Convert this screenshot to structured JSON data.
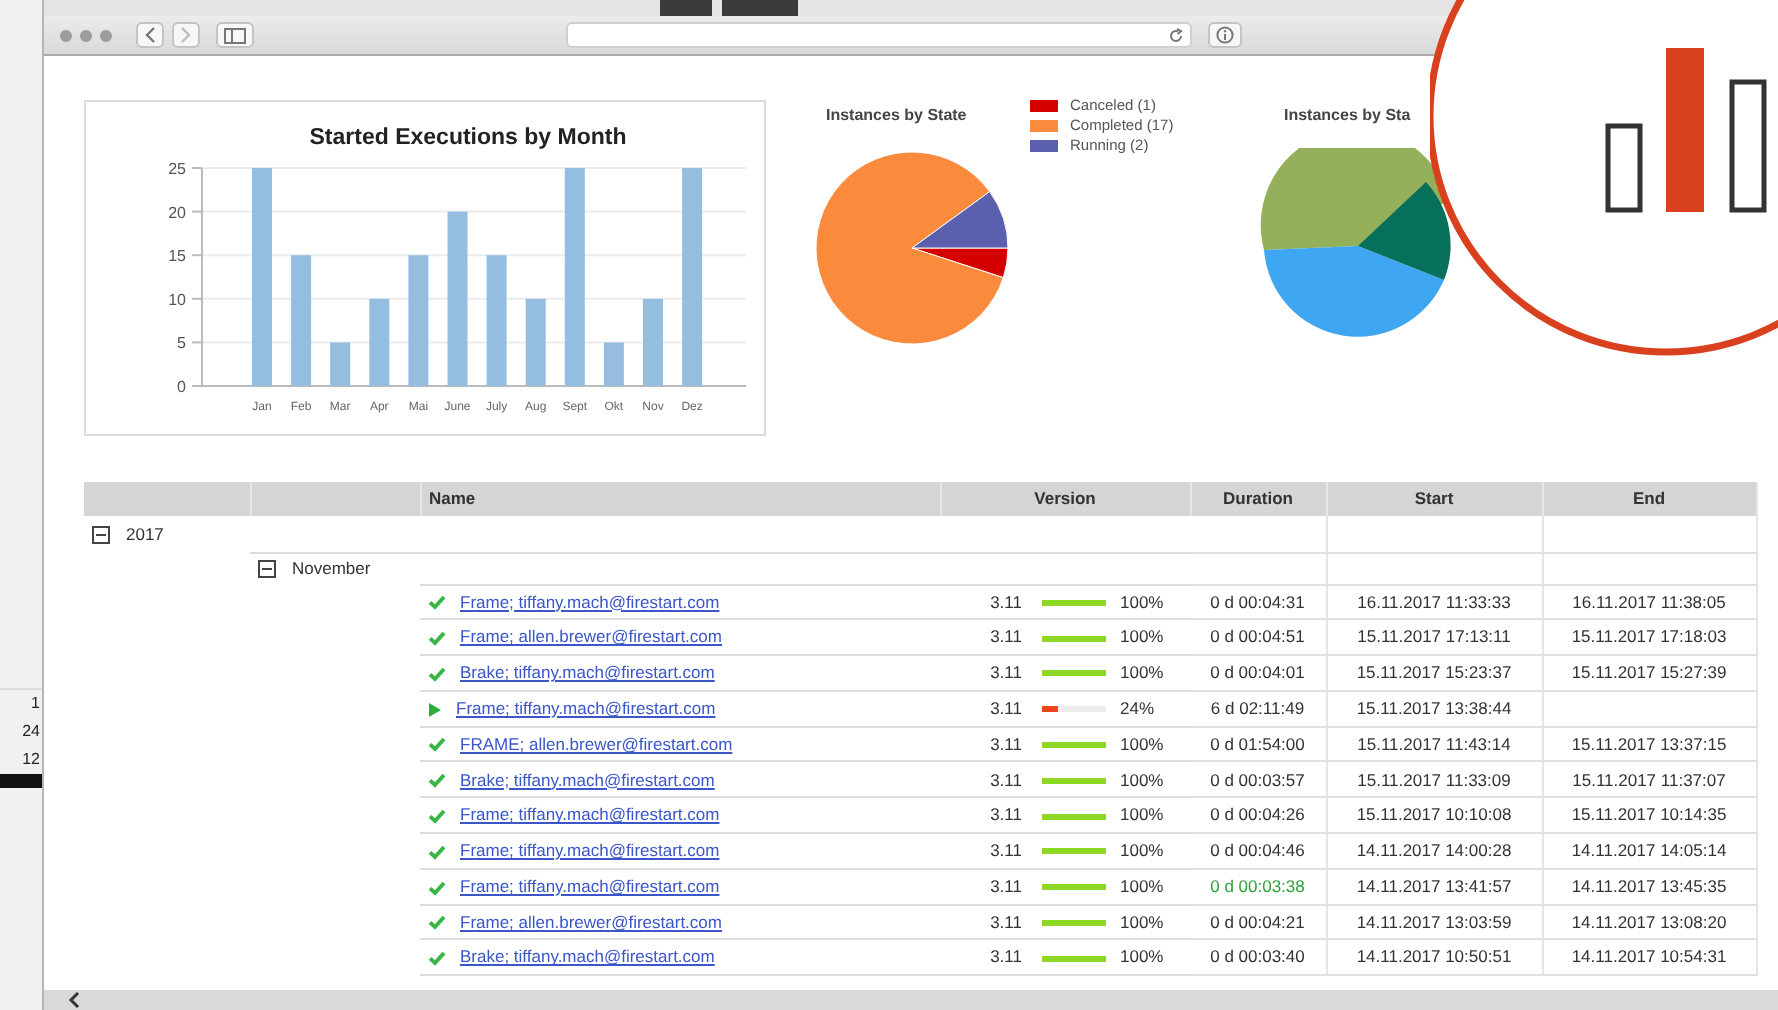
{
  "side_sheet": {
    "cells": [
      "1",
      "24",
      "12"
    ]
  },
  "bar_chart": {
    "chart_data": {
      "type": "bar",
      "title": "Started Executions by Month",
      "categories": [
        "Jan",
        "Feb",
        "Mar",
        "Apr",
        "Mai",
        "June",
        "July",
        "Aug",
        "Sept",
        "Okt",
        "Nov",
        "Dez"
      ],
      "series": [
        {
          "color": "#95bde0",
          "values": [
            25,
            15,
            5,
            10,
            15,
            20,
            15,
            10,
            25,
            5,
            10,
            25
          ]
        }
      ],
      "ylim": [
        0,
        25
      ],
      "yticks": [
        0,
        5,
        10,
        15,
        20,
        25
      ],
      "grid": true
    }
  },
  "state_pie": {
    "title": "Instances by State",
    "legend": [
      {
        "color": "#d40000"
      },
      {
        "color": "#fa8a3c"
      },
      {
        "color": "#5a5fae"
      }
    ],
    "chart_data": {
      "type": "pie",
      "categories": [
        "Canceled (1)",
        "Completed (17)",
        "Running (2)"
      ],
      "values": [
        1,
        17,
        2
      ]
    }
  },
  "second_pie": {
    "title": "Instances by Sta"
  },
  "table": {
    "columns": [
      "Name",
      "Version",
      "Duration",
      "Start",
      "End"
    ],
    "groups": [
      {
        "label": "2017",
        "expanded": true,
        "children": [
          {
            "label": "November",
            "expanded": true,
            "rows": [
              {
                "kind": "completed",
                "name": "Frame; tiffany.mach@firestart.com",
                "version": "3.11",
                "level": 1,
                "percent": "100%",
                "duration": "0 d 00:04:31",
                "highlight": false,
                "start": "16.11.2017 11:33:33",
                "end": "16.11.2017 11:38:05"
              },
              {
                "kind": "completed",
                "name": "Frame; allen.brewer@firestart.com",
                "version": "3.11",
                "level": 1,
                "percent": "100%",
                "duration": "0 d 00:04:51",
                "highlight": false,
                "start": "15.11.2017 17:13:11",
                "end": "15.11.2017 17:18:03"
              },
              {
                "kind": "completed",
                "name": "Brake; tiffany.mach@firestart.com",
                "version": "3.11",
                "level": 1,
                "percent": "100%",
                "duration": "0 d 00:04:01",
                "highlight": false,
                "start": "15.11.2017 15:23:37",
                "end": "15.11.2017 15:27:39"
              },
              {
                "kind": "running",
                "name": "Frame; tiffany.mach@firestart.com",
                "version": "3.11",
                "level": 0.24,
                "percent": "24%",
                "duration": "6 d 02:11:49",
                "highlight": false,
                "start": "15.11.2017 13:38:44"
              },
              {
                "kind": "completed",
                "name": "FRAME; allen.brewer@firestart.com",
                "version": "3.11",
                "level": 1,
                "percent": "100%",
                "duration": "0 d 01:54:00",
                "highlight": false,
                "start": "15.11.2017 11:43:14",
                "end": "15.11.2017 13:37:15"
              },
              {
                "kind": "completed",
                "name": "Brake; tiffany.mach@firestart.com",
                "version": "3.11",
                "level": 1,
                "percent": "100%",
                "duration": "0 d 00:03:57",
                "highlight": false,
                "start": "15.11.2017 11:33:09",
                "end": "15.11.2017 11:37:07"
              },
              {
                "kind": "completed",
                "name": "Frame; tiffany.mach@firestart.com",
                "version": "3.11",
                "level": 1,
                "percent": "100%",
                "duration": "0 d 00:04:26",
                "highlight": false,
                "start": "15.11.2017 10:10:08",
                "end": "15.11.2017 10:14:35"
              },
              {
                "kind": "completed",
                "name": "Frame; tiffany.mach@firestart.com",
                "version": "3.11",
                "level": 1,
                "percent": "100%",
                "duration": "0 d 00:04:46",
                "highlight": false,
                "start": "14.11.2017 14:00:28",
                "end": "14.11.2017 14:05:14"
              },
              {
                "kind": "completed",
                "name": "Frame; tiffany.mach@firestart.com",
                "version": "3.11",
                "level": 1,
                "percent": "100%",
                "duration": "0 d 00:03:38",
                "highlight": true,
                "start": "14.11.2017 13:41:57",
                "end": "14.11.2017 13:45:35"
              },
              {
                "kind": "completed",
                "name": "Frame; allen.brewer@firestart.com",
                "version": "3.11",
                "level": 1,
                "percent": "100%",
                "duration": "0 d 00:04:21",
                "highlight": false,
                "start": "14.11.2017 13:03:59",
                "end": "14.11.2017 13:08:20"
              },
              {
                "kind": "completed",
                "name": "Brake; tiffany.mach@firestart.com",
                "version": "3.11",
                "level": 1,
                "percent": "100%",
                "duration": "0 d 00:03:40",
                "highlight": false,
                "start": "14.11.2017 10:50:51",
                "end": "14.11.2017 10:54:31"
              }
            ]
          }
        ]
      }
    ]
  }
}
